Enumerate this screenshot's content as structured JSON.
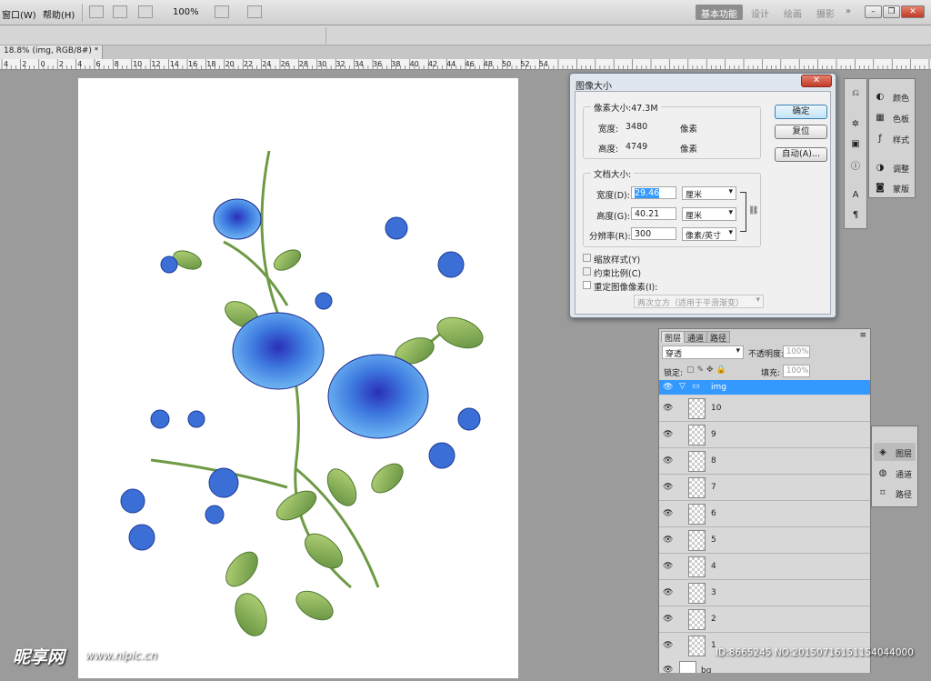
{
  "menu": {
    "window": "窗口(W)",
    "help": "帮助(H)",
    "zoom": "100%"
  },
  "workspaces": [
    "基本功能",
    "设计",
    "绘画",
    "摄影"
  ],
  "workspace_more": "»",
  "document_tab": "18.8% (img, RGB/8#) *",
  "ruler_labels": [
    "4",
    "2",
    "0",
    "2",
    "4",
    "6",
    "8",
    "10",
    "12",
    "14",
    "16",
    "18",
    "20",
    "22",
    "24",
    "26",
    "28",
    "30",
    "32",
    "34",
    "36",
    "38",
    "40",
    "42",
    "44",
    "46",
    "48",
    "50",
    "52",
    "54"
  ],
  "dialog": {
    "title": "图像大小",
    "close": "✕",
    "pixel_group": "像素大小:47.3M",
    "pixel_width_label": "宽度:",
    "pixel_width": "3480",
    "pixel_width_unit": "像素",
    "pixel_height_label": "高度:",
    "pixel_height": "4749",
    "pixel_height_unit": "像素",
    "doc_group": "文档大小:",
    "doc_width_label": "宽度(D):",
    "doc_width": "29.46",
    "doc_width_unit": "厘米",
    "doc_height_label": "高度(G):",
    "doc_height": "40.21",
    "doc_height_unit": "厘米",
    "res_label": "分辨率(R):",
    "res": "300",
    "res_unit": "像素/英寸",
    "ok": "确定",
    "reset": "复位",
    "auto": "自动(A)...",
    "scale_styles": "缩放样式(Y)",
    "constrain": "约束比例(C)",
    "resample": "重定图像像素(I):",
    "resample_method": "两次立方（适用于平滑渐变）"
  },
  "layers_panel": {
    "tabs": [
      "图层",
      "通道",
      "路径"
    ],
    "blend_mode": "穿透",
    "opacity_label": "不透明度:",
    "opacity": "100%",
    "lock_label": "锁定:",
    "fill_label": "填充:",
    "fill": "100%",
    "group_name": "img",
    "layers": [
      "10",
      "9",
      "8",
      "7",
      "6",
      "5",
      "4",
      "3",
      "2",
      "1"
    ],
    "bg_name": "bg"
  },
  "right_dock": {
    "items": [
      "颜色",
      "色板",
      "样式",
      "调整",
      "蒙版"
    ]
  },
  "lower_dock": {
    "items": [
      "图层",
      "通道",
      "路径"
    ]
  },
  "watermark": {
    "logo": "昵享网",
    "url": "www.nipic.cn",
    "id": "ID:8665245 NO:20150716151154044000"
  }
}
